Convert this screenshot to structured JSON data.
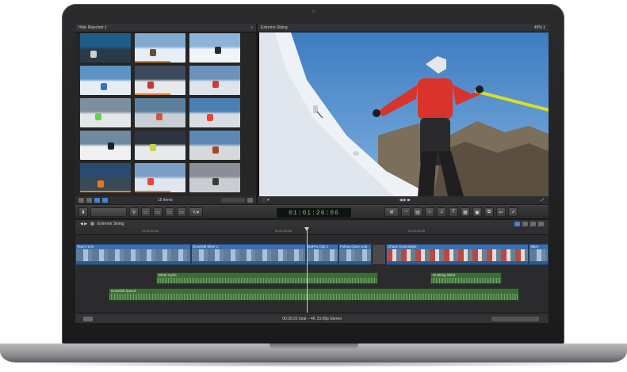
{
  "browser": {
    "filter_label": "Hide Rejected ‡",
    "items_label": "15 items",
    "thumbnails": [
      {
        "sky": "#1e5c8a",
        "ground": "#2a3a48",
        "fig": "#d0d0d0"
      },
      {
        "sky": "#7fa9cf",
        "ground": "#e9eef4",
        "fig": "#6b4b3a"
      },
      {
        "sky": "#8db4d8",
        "ground": "#f2f4f7",
        "fig": "#2a2a2a"
      },
      {
        "sky": "#5b93c6",
        "ground": "#e7edf4",
        "fig": "#3a6fd0"
      },
      {
        "sky": "#3c4a5c",
        "ground": "#e8e9ea",
        "fig": "#c23b33"
      },
      {
        "sky": "#6b92bd",
        "ground": "#dfe4ea",
        "fig": "#d03a3a"
      },
      {
        "sky": "#7d8f9e",
        "ground": "#e4e6e8",
        "fig": "#6ad04a"
      },
      {
        "sky": "#5c7f9e",
        "ground": "#c9ced4",
        "fig": "#d2553a"
      },
      {
        "sky": "#4b7fb2",
        "ground": "#d8dde3",
        "fig": "#e04a3a"
      },
      {
        "sky": "#6f8aa0",
        "ground": "#eef0f2",
        "fig": "#202020"
      },
      {
        "sky": "#2e3540",
        "ground": "#e9eaeb",
        "fig": "#c9d24a"
      },
      {
        "sky": "#5d88b4",
        "ground": "#d6d8db",
        "fig": "#a04a2a"
      },
      {
        "sky": "#2b4a6f",
        "ground": "#3a4a55",
        "fig": "#e0782a"
      },
      {
        "sky": "#7aa0c8",
        "ground": "#dfe6ee",
        "fig": "#e04a3a"
      },
      {
        "sky": "#8a8f95",
        "ground": "#c9ccd0",
        "fig": "#3a3a3a"
      }
    ]
  },
  "viewer": {
    "title": "Extreme Skiing",
    "zoom": "45% ‡"
  },
  "toolbar": {
    "timecode": "01:01:26:06"
  },
  "timeline": {
    "project_name": "Extreme Skiing",
    "ruler": [
      "01:01:20:00",
      "01:01:25:00",
      "01:01:30:00"
    ],
    "primary_clips": [
      {
        "label": "Team runs"
      },
      {
        "label": "Downhill Skier 1"
      },
      {
        "label": "GoPro Clip 4"
      },
      {
        "label": "Follow close cuts"
      },
      {
        "label": "Chase Downslope"
      },
      {
        "label": "Skier"
      }
    ],
    "audio_clips": [
      {
        "label": "Wide Cycle"
      },
      {
        "label": "Rushing Wind"
      },
      {
        "label": "Downhill Speed"
      }
    ]
  },
  "status": {
    "text": "00:30:22 total – 4K 23.98p Stereo"
  }
}
